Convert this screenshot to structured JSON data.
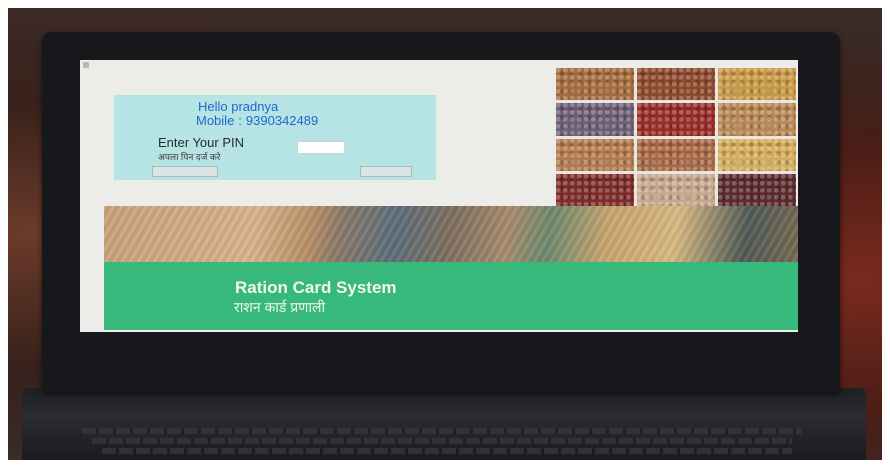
{
  "login": {
    "hello": "Hello pradnya",
    "mobile_label": "Mobile",
    "mobile_sep": ":",
    "mobile_number": "9390342489",
    "pin_label": "Enter Your PIN",
    "pin_label_hi": "अपला पिन दर्ज करे",
    "pin_value": ""
  },
  "buttons": {
    "left_label": "",
    "right_label": ""
  },
  "footer": {
    "title": "Ration Card System",
    "title_hi": "राशन कार्ड प्रणाली"
  },
  "colors": {
    "panel_bg": "#b6e3e3",
    "greeting_text": "#1e67d2",
    "footer_bg": "#37b97b"
  },
  "grain_tiles": [
    {
      "name": "grain-tile-wheat",
      "color": "#a56a3c"
    },
    {
      "name": "grain-tile-almond",
      "color": "#8c4a2c"
    },
    {
      "name": "grain-tile-millet",
      "color": "#c99844"
    },
    {
      "name": "grain-tile-mixed-beans",
      "color": "#6d5e74"
    },
    {
      "name": "grain-tile-red-beans",
      "color": "#9a2a26"
    },
    {
      "name": "grain-tile-grain-scoop",
      "color": "#b88754"
    },
    {
      "name": "grain-tile-lentils",
      "color": "#b47a4c"
    },
    {
      "name": "grain-tile-peanuts",
      "color": "#a86844"
    },
    {
      "name": "grain-tile-yellow-dal",
      "color": "#d4ad5a"
    },
    {
      "name": "grain-tile-kidney-beans",
      "color": "#7e2c2a"
    },
    {
      "name": "grain-tile-rice",
      "color": "#c7a88c"
    },
    {
      "name": "grain-tile-rajma",
      "color": "#5c2a2e"
    }
  ]
}
